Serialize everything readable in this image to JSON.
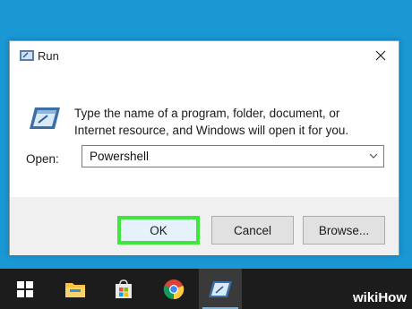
{
  "dialog": {
    "title": "Run",
    "description": "Type the name of a program, folder, document, or Internet resource, and Windows will open it for you.",
    "open_label": "Open:",
    "open_value": "Powershell",
    "ok_label": "OK",
    "cancel_label": "Cancel",
    "browse_label": "Browse..."
  },
  "taskbar": {
    "items": [
      {
        "icon": "windows-start-icon"
      },
      {
        "icon": "file-explorer-icon"
      },
      {
        "icon": "microsoft-store-icon"
      },
      {
        "icon": "chrome-icon"
      },
      {
        "icon": "run-app-icon",
        "active": true
      }
    ]
  },
  "watermark": {
    "text": "wikiHow"
  },
  "colors": {
    "desktop": "#1a98d4",
    "ok_highlight": "#3ee83a",
    "taskbar": "#1c1c1c"
  }
}
